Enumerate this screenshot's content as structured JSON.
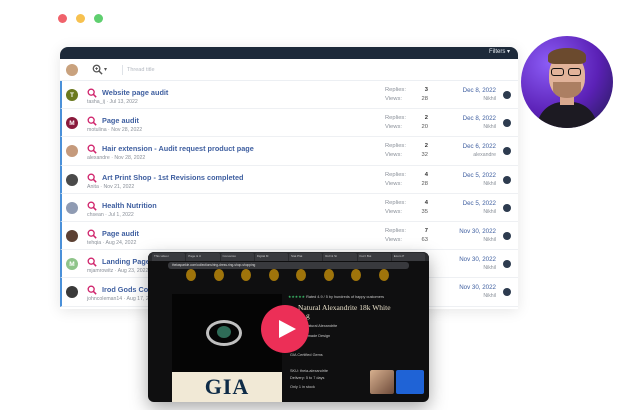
{
  "window_dots": [
    "#f0626b",
    "#f7c14f",
    "#5fcf6f"
  ],
  "toolbar": {
    "filters_label": "Filters ▾",
    "title_placeholder": "Thread title"
  },
  "labels": {
    "replies": "Replies:",
    "views": "Views:"
  },
  "threads": [
    {
      "title": "Website page audit",
      "author": "tasha_ij",
      "date_started": "Jul 13, 2022",
      "replies": "3",
      "views": "28",
      "last_date": "Dec 8, 2022",
      "last_by": "Nikhil",
      "avatar_letter": "T",
      "avatar_color": "#6b7a1f"
    },
    {
      "title": "Page audit",
      "author": "motulina",
      "date_started": "Nov 28, 2022",
      "replies": "2",
      "views": "20",
      "last_date": "Dec 8, 2022",
      "last_by": "Nikhil",
      "avatar_letter": "M",
      "avatar_color": "#8a1a3c"
    },
    {
      "title": "Hair extension - Audit request product page",
      "author": "alexandre",
      "date_started": "Nov 28, 2022",
      "replies": "2",
      "views": "32",
      "last_date": "Dec 6, 2022",
      "last_by": "alexandre",
      "avatar_letter": "",
      "avatar_color": "#c59a7c"
    },
    {
      "title": "Art Print Shop - 1st Revisions completed",
      "author": "Anita",
      "date_started": "Nov 21, 2022",
      "replies": "4",
      "views": "28",
      "last_date": "Dec 5, 2022",
      "last_by": "Nikhil",
      "avatar_letter": "",
      "avatar_color": "#4a4a4a"
    },
    {
      "title": "Health Nutrition",
      "author": "chsean",
      "date_started": "Jul 1, 2022",
      "replies": "4",
      "views": "35",
      "last_date": "Dec 5, 2022",
      "last_by": "Nikhil",
      "avatar_letter": "",
      "avatar_color": "#8f9bb3"
    },
    {
      "title": "Page audit",
      "author": "tehqia",
      "date_started": "Aug 24, 2022",
      "replies": "7",
      "views": "63",
      "last_date": "Nov 30, 2022",
      "last_by": "Nikhil",
      "avatar_letter": "",
      "avatar_color": "#5c4033"
    },
    {
      "title": "Landing Page",
      "author": "mjamrowitz",
      "date_started": "Aug 23, 2022",
      "replies": "",
      "views": "",
      "last_date": "Nov 30, 2022",
      "last_by": "Nikhil",
      "avatar_letter": "M",
      "avatar_color": "#8fc48a"
    },
    {
      "title": "Irod Gods Co",
      "author": "johncoleman14",
      "date_started": "Aug 17, 2022",
      "replies": "",
      "views": "",
      "last_date": "Nov 30, 2022",
      "last_by": "Nikhil",
      "avatar_letter": "",
      "avatar_color": "#3a3a3a"
    }
  ],
  "video": {
    "tabs": [
      "This video i",
      "Page & U",
      "Conversio",
      "Digital M",
      "Stat Plat",
      "Roll & St",
      "Fuzz Bot",
      "Ecom P"
    ],
    "url": "theiasparkle.com/collections/ring-dress-ring-shop-shopping",
    "rating_stars": "★★★★★",
    "rating_text": "Rated 4.9 / 5 by hundreds of happy customers",
    "product_title_1": "Natural Alexandrite 18k White",
    "product_title_2": "g",
    "line_1": "Sourced Natural Alexandrite",
    "line_2": "Kind Handmade Design",
    "line_3": "GIA Certified Gems",
    "line_4": "SKU: theia-alexandrite",
    "line_5": "Delivery: 5 to 7 days",
    "line_6": "Only 1 in stock",
    "gia_logo": "GIA"
  }
}
